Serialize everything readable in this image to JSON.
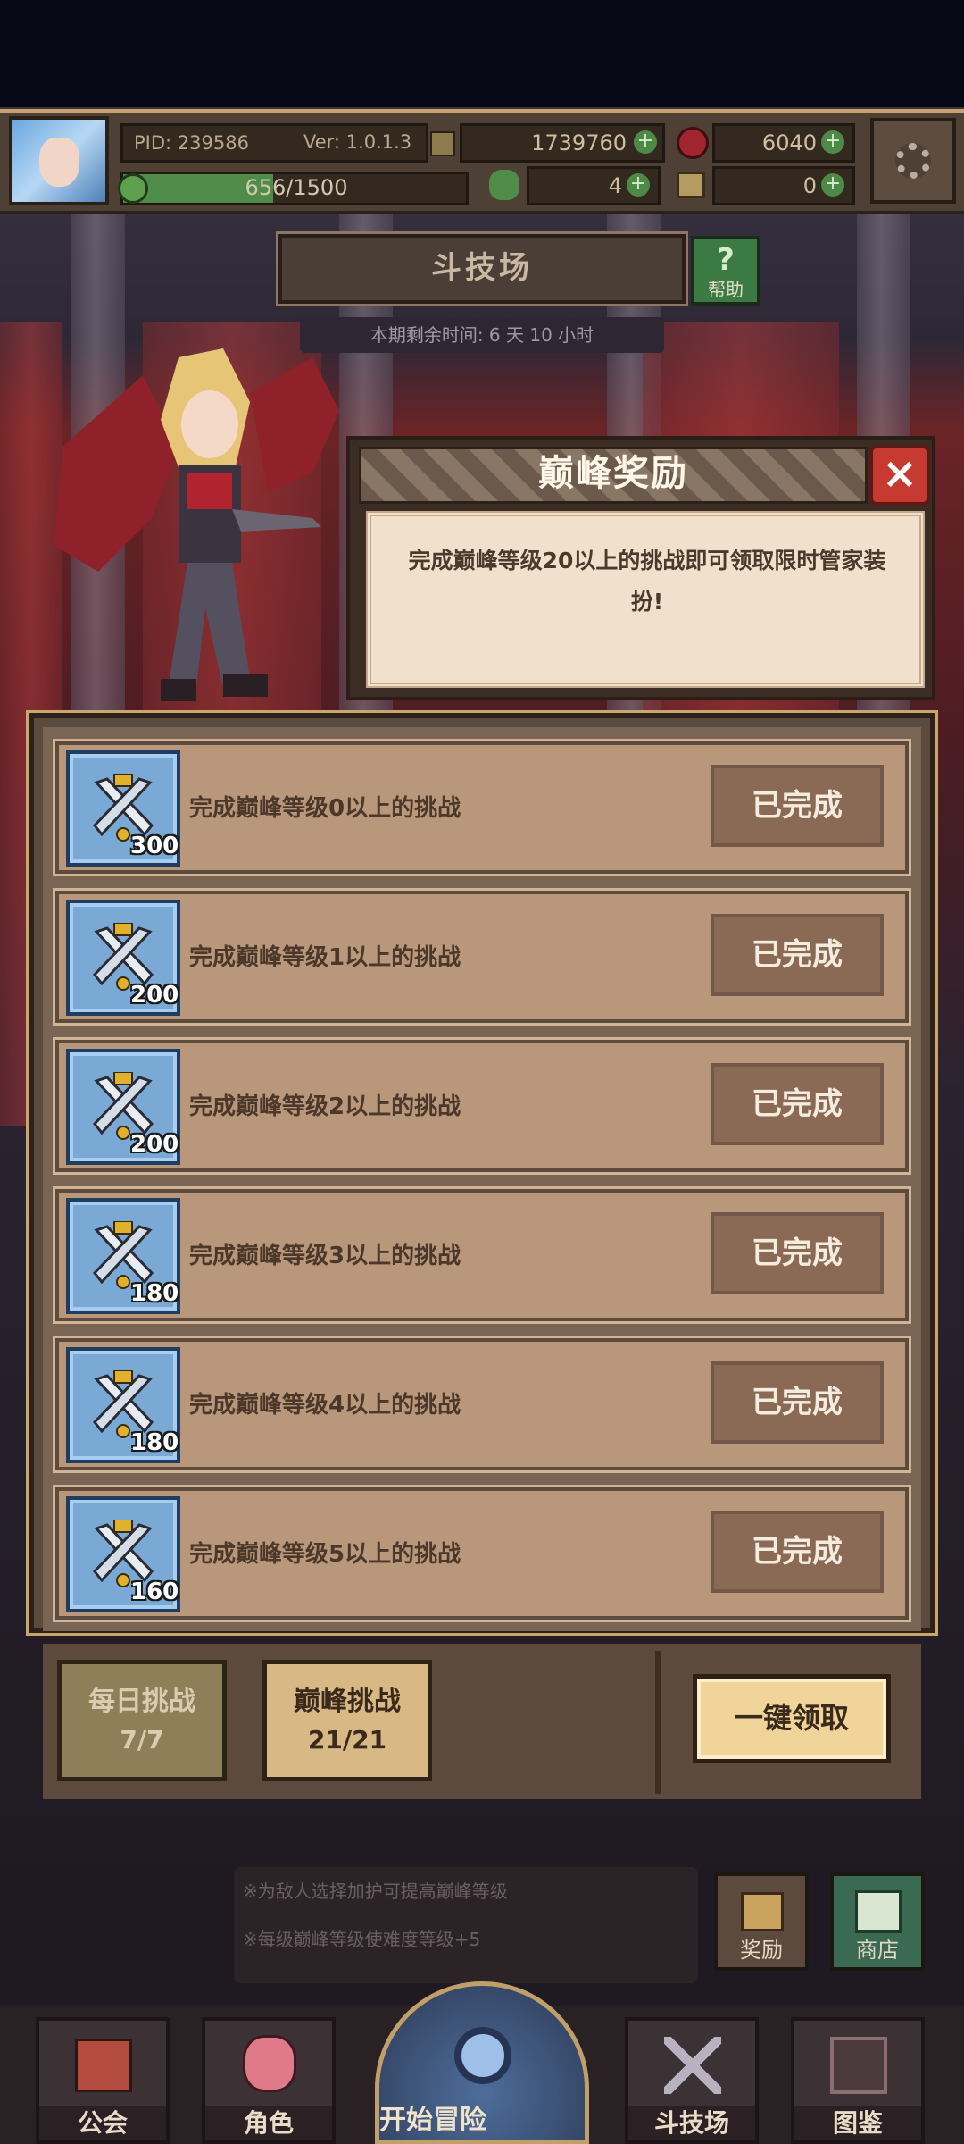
{
  "topbar": {
    "pid": "PID: 239586",
    "version": "Ver: 1.0.1.3",
    "gold": "1739760",
    "gems": "6040",
    "xp": "656/1500",
    "xp_progress": 0.437,
    "clover": "4",
    "keys": "0"
  },
  "arena": {
    "title": "斗技场",
    "help_label": "帮助",
    "period": "本期剩余时间: 6 天 10 小时"
  },
  "peak_dialog": {
    "title": "巅峰奖励",
    "description": "完成巅峰等级20以上的挑战即可领取限时管家装扮!"
  },
  "rewards": [
    {
      "desc": "完成巅峰等级0以上的挑战",
      "qty": "300",
      "status": "已完成"
    },
    {
      "desc": "完成巅峰等级1以上的挑战",
      "qty": "200",
      "status": "已完成"
    },
    {
      "desc": "完成巅峰等级2以上的挑战",
      "qty": "200",
      "status": "已完成"
    },
    {
      "desc": "完成巅峰等级3以上的挑战",
      "qty": "180",
      "status": "已完成"
    },
    {
      "desc": "完成巅峰等级4以上的挑战",
      "qty": "180",
      "status": "已完成"
    },
    {
      "desc": "完成巅峰等级5以上的挑战",
      "qty": "160",
      "status": "已完成"
    }
  ],
  "tabs": {
    "daily": {
      "label": "每日挑战",
      "count": "7/7"
    },
    "peak": {
      "label": "巅峰挑战",
      "count": "21/21"
    },
    "claim_all": "一键领取"
  },
  "hints": [
    "※为敌人选择加护可提高巅峰等级",
    "※每级巅峰等级使难度等级+5"
  ],
  "side_buttons": {
    "reward": "奖励",
    "shop": "商店"
  },
  "nav": {
    "guild": "公会",
    "character": "角色",
    "adventure": "开始冒险",
    "arena": "斗技场",
    "codex": "图鉴"
  },
  "colors": {
    "panel": "#5b4a3e",
    "row": "#b9977a",
    "status_button": "#8a6a55",
    "close_button": "#c73a32",
    "accent_gold": "#c8a66c"
  }
}
